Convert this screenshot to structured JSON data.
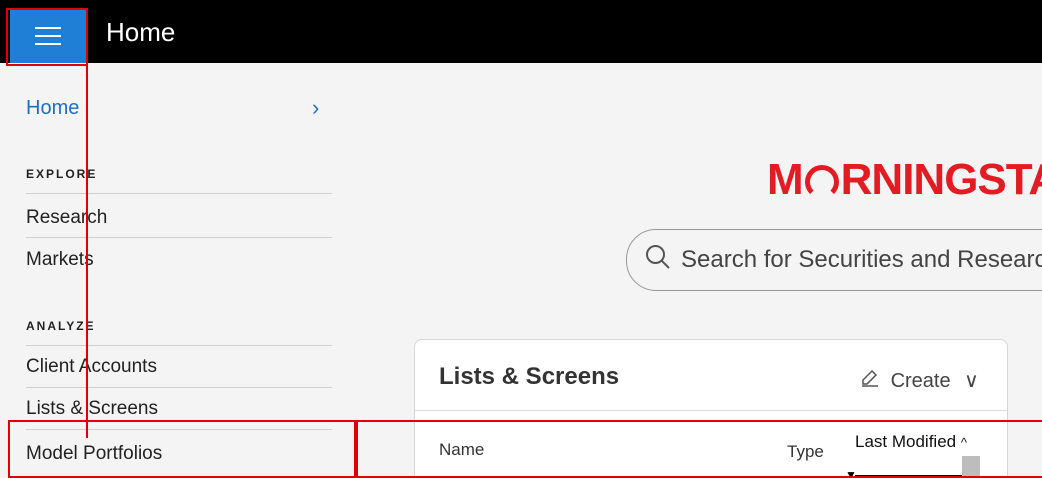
{
  "topbar": {
    "title": "Home",
    "menu_icon": "hamburger-icon",
    "accent": "#1f7fd6"
  },
  "sidebar": {
    "home_label": "Home",
    "chevron": "›",
    "sections": [
      {
        "label": "EXPLORE",
        "items": [
          "Research",
          "Markets"
        ]
      },
      {
        "label": "ANALYZE",
        "items": [
          "Client Accounts",
          "Lists & Screens",
          "Model Portfolios"
        ]
      }
    ]
  },
  "main": {
    "logo_left": "M",
    "logo_right": "RNINGSTAR",
    "logo_color": "#e31b23",
    "search_placeholder": "Search for Securities and Research",
    "card": {
      "title": "Lists & Screens",
      "create_label": "Create",
      "create_chevron": "∨",
      "columns": {
        "name": "Name",
        "type": "Type",
        "last_modified": "Last Modified",
        "sort_indicator": "^"
      }
    }
  },
  "highlight_color": "#e00000"
}
